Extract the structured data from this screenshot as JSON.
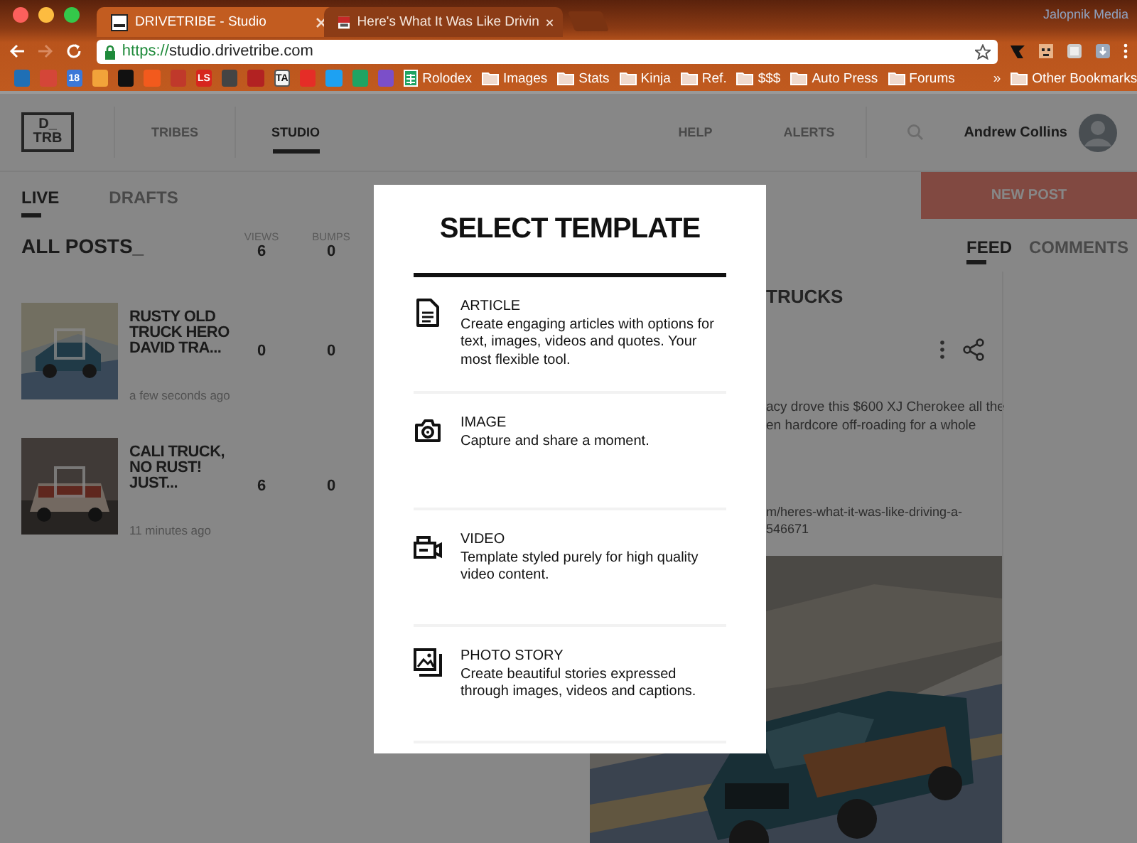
{
  "browser": {
    "tabs": [
      {
        "title": "DRIVETRIBE - Studio",
        "selected": true
      },
      {
        "title": "Here's What It Was Like Drivin",
        "selected": false
      }
    ],
    "profile": "Jalopnik Media",
    "address": {
      "secure": true,
      "scheme": "https://",
      "host": "studio.drivetribe.com"
    },
    "bookmarks": [
      {
        "kind": "site",
        "color": "#1f6fb5"
      },
      {
        "kind": "site",
        "color": "#d44638"
      },
      {
        "kind": "site",
        "color": "#3b78d8",
        "glyph": "18"
      },
      {
        "kind": "site",
        "color": "#f2a33a"
      },
      {
        "kind": "site",
        "color": "#111111"
      },
      {
        "kind": "site",
        "color": "#f25a1d"
      },
      {
        "kind": "site",
        "color": "#c0392b"
      },
      {
        "kind": "site",
        "color": "#d7261e",
        "glyph": "LS"
      },
      {
        "kind": "site",
        "color": "#444444"
      },
      {
        "kind": "site",
        "color": "#b22222"
      },
      {
        "kind": "site",
        "color": "#f4f4f4",
        "glyph": "TA"
      },
      {
        "kind": "site",
        "color": "#e52d27"
      },
      {
        "kind": "site",
        "color": "#1da1f2"
      },
      {
        "kind": "site",
        "color": "#1fa463"
      },
      {
        "kind": "site",
        "color": "#7b4fc9"
      },
      {
        "kind": "sheet",
        "label": "Rolodex"
      },
      {
        "kind": "folder",
        "label": "Images"
      },
      {
        "kind": "folder",
        "label": "Stats"
      },
      {
        "kind": "folder",
        "label": "Kinja"
      },
      {
        "kind": "folder",
        "label": "Ref."
      },
      {
        "kind": "folder",
        "label": "$$$"
      },
      {
        "kind": "folder",
        "label": "Auto Press"
      },
      {
        "kind": "folder",
        "label": "Forums"
      }
    ],
    "more_bookmarks": "»",
    "other_bookmarks": "Other Bookmarks"
  },
  "site": {
    "logo": [
      "D_",
      "TRB"
    ],
    "nav": [
      {
        "label": "TRIBES",
        "selected": false
      },
      {
        "label": "STUDIO",
        "selected": true
      }
    ],
    "utility_nav": [
      "HELP",
      "ALERTS"
    ],
    "user": "Andrew Collins"
  },
  "studio": {
    "tabs": [
      {
        "label": "LIVE",
        "selected": true
      },
      {
        "label": "DRAFTS",
        "selected": false
      }
    ],
    "new_post": "NEW POST",
    "heading": "ALL POSTS_",
    "columns": [
      {
        "label": "VIEWS",
        "total": "6"
      },
      {
        "label": "BUMPS",
        "total": "0"
      }
    ],
    "posts": [
      {
        "title": "RUSTY OLD TRUCK HERO DAVID TRA...",
        "views": "0",
        "bumps": "0",
        "time": "a few seconds ago"
      },
      {
        "title": "CALI TRUCK, NO RUST! JUST...",
        "views": "6",
        "bumps": "0",
        "time": "11 minutes ago"
      }
    ]
  },
  "feed": {
    "tabs": [
      {
        "label": "FEED",
        "selected": true
      },
      {
        "label": "COMMENTS",
        "selected": false
      }
    ],
    "post": {
      "title": "TRUCKS",
      "text": [
        "acy drove this $600 XJ Cherokee all the",
        "en hardcore off-roading for a whole"
      ],
      "link": [
        "m/heres-what-it-was-like-driving-a-",
        "546671"
      ]
    }
  },
  "dialog": {
    "title": "SELECT TEMPLATE",
    "templates": [
      {
        "kind": "article",
        "name": "ARTICLE",
        "description": "Create engaging articles with options for text, images, videos and quotes. Your most flexible tool."
      },
      {
        "name": "IMAGE",
        "description": "Capture and share a moment."
      },
      {
        "kind": "video",
        "name": "VIDEO",
        "description": "Template styled purely for high quality video content."
      },
      {
        "kind": "photo_story",
        "name": "PHOTO STORY",
        "description": "Create beautiful stories expressed through images, videos and captions."
      }
    ]
  }
}
